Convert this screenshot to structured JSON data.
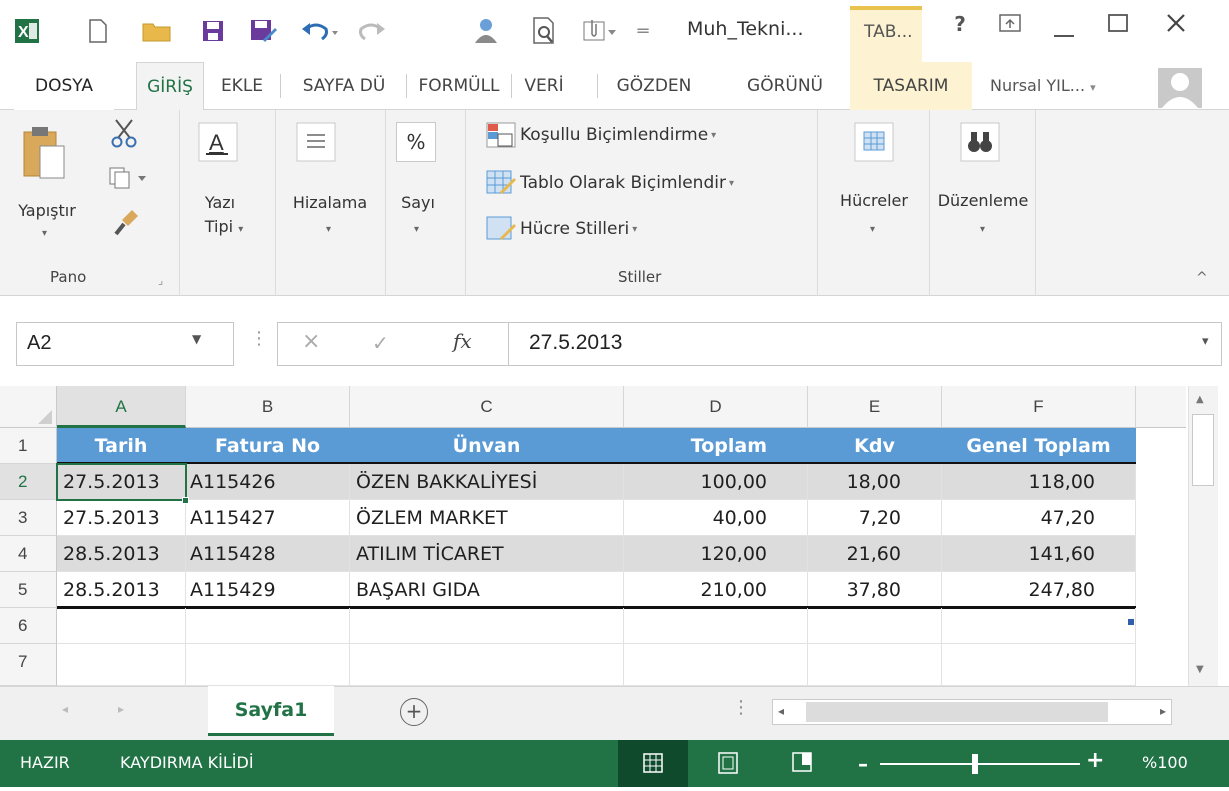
{
  "title": {
    "text": "Muh_Tekni...",
    "contextual_tab": "TAB...",
    "help": "?"
  },
  "tabs": [
    {
      "label": "DOSYA",
      "state": "file"
    },
    {
      "label": "GİRİŞ",
      "state": "active"
    },
    {
      "label": "EKLE",
      "state": ""
    },
    {
      "label": "SAYFA DÜ",
      "state": ""
    },
    {
      "label": "FORMÜLL",
      "state": ""
    },
    {
      "label": "VERİ",
      "state": ""
    },
    {
      "label": "GÖZDEN",
      "state": ""
    },
    {
      "label": "GÖRÜNÜ",
      "state": ""
    },
    {
      "label": "TASARIM",
      "state": "contextual"
    }
  ],
  "user": "Nursal YIL...",
  "ribbon": {
    "paste": "Yapıştır",
    "clipboard_group": "Pano",
    "font_line1": "Yazı",
    "font_line2": "Tipi",
    "alignment": "Hizalama",
    "number_symbol": "%",
    "number": "Sayı",
    "cond_format": "Koşullu Biçimlendirme",
    "format_table": "Tablo Olarak Biçimlendir",
    "cell_styles": "Hücre Stilleri",
    "styles_group": "Stiller",
    "cells": "Hücreler",
    "editing": "Düzenleme"
  },
  "formula_bar": {
    "name_box": "A2",
    "formula": "27.5.2013",
    "fx": "fx"
  },
  "columns": [
    "A",
    "B",
    "C",
    "D",
    "E",
    "F"
  ],
  "row_numbers": [
    "1",
    "2",
    "3",
    "4",
    "5",
    "6",
    "7"
  ],
  "table": {
    "headers": [
      "Tarih",
      "Fatura No",
      "Ünvan",
      "Toplam",
      "Kdv",
      "Genel Toplam"
    ],
    "rows": [
      [
        "27.5.2013",
        "A115426",
        "ÖZEN BAKKALİYESİ",
        "100,00",
        "18,00",
        "118,00"
      ],
      [
        "27.5.2013",
        "A115427",
        "ÖZLEM MARKET",
        "40,00",
        "7,20",
        "47,20"
      ],
      [
        "28.5.2013",
        "A115428",
        "ATILIM TİCARET",
        "120,00",
        "21,60",
        "141,60"
      ],
      [
        "28.5.2013",
        "A115429",
        "BAŞARI GIDA",
        "210,00",
        "37,80",
        "247,80"
      ]
    ]
  },
  "sheet_tabs": {
    "active": "Sayfa1",
    "add": "+"
  },
  "status": {
    "ready": "HAZIR",
    "scroll_lock": "KAYDIRMA KİLİDİ",
    "zoom": "%100"
  },
  "colors": {
    "excel_green": "#217346",
    "table_header": "#5b9bd5",
    "band": "#dcdcdc",
    "contextual": "#fdf2d2"
  }
}
